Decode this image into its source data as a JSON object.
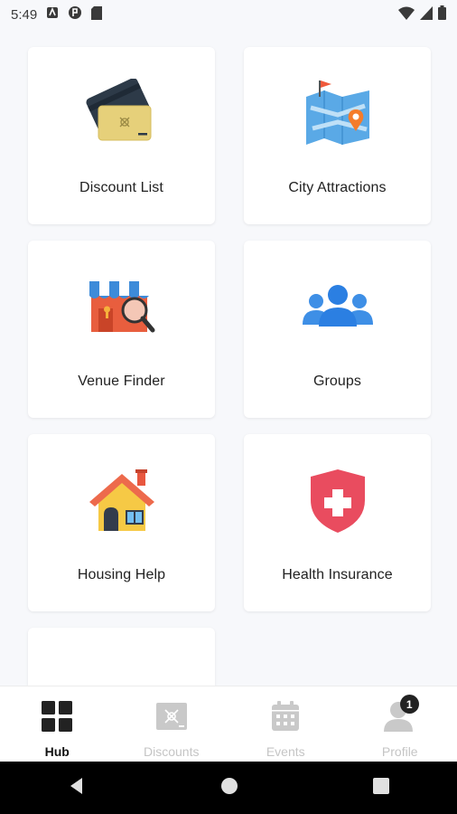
{
  "status": {
    "time": "5:49"
  },
  "cards": [
    {
      "label": "Discount List",
      "icon": "discount-cards-icon"
    },
    {
      "label": "City Attractions",
      "icon": "city-map-icon"
    },
    {
      "label": "Venue Finder",
      "icon": "venue-search-icon"
    },
    {
      "label": "Groups",
      "icon": "groups-icon"
    },
    {
      "label": "Housing Help",
      "icon": "house-icon"
    },
    {
      "label": "Health Insurance",
      "icon": "health-shield-icon"
    }
  ],
  "nav": [
    {
      "label": "Hub",
      "icon": "grid-icon",
      "active": true
    },
    {
      "label": "Discounts",
      "icon": "discount-card-icon"
    },
    {
      "label": "Events",
      "icon": "calendar-icon"
    },
    {
      "label": "Profile",
      "icon": "user-icon",
      "badge": "1"
    }
  ]
}
